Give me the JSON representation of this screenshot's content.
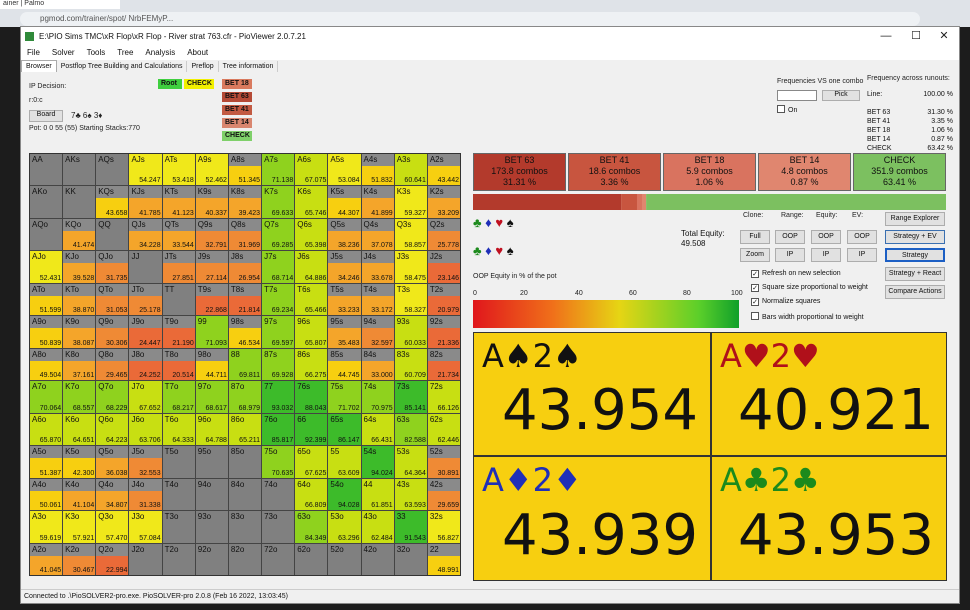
{
  "browser": {
    "tab": "ainer | Palmo",
    "url": "pgmod.com/trainer/spot/ NrbFEMyP..."
  },
  "window": {
    "title": "E:\\PIO Sims TMC\\xR Flop\\xR Flop - River strat 763.cfr - PioViewer 2.0.7.21",
    "minimize": "—",
    "maximize": "☐",
    "close": "✕"
  },
  "menu": [
    "File",
    "Solver",
    "Tools",
    "Tree",
    "Analysis",
    "About"
  ],
  "tabs": [
    "Browser",
    "Postflop Tree Building and Calculations",
    "Preflop",
    "Tree information"
  ],
  "decision": {
    "label": "IP Decision:",
    "hand": "r:0:c",
    "board_btn": "Board",
    "board_cards": "7♣ 6♠ 3♦",
    "pot": "Pot: 0 0 55 (55) Starting Stacks:770"
  },
  "tree": {
    "root": "Root",
    "check": "CHECK",
    "actions": [
      "BET 18",
      "BET 63",
      "BET 41",
      "BET 14",
      "CHECK"
    ]
  },
  "freq_vs": {
    "label": "Frequencies VS one combo",
    "pick": "Pick",
    "on": "On"
  },
  "freq_runouts": {
    "label": "Frequency across runouts:",
    "rows": [
      [
        "Line:",
        "100.00 %"
      ],
      [
        "BET 63",
        "31.30 %"
      ],
      [
        "BET 41",
        "3.35 %"
      ],
      [
        "BET 18",
        "1.06 %"
      ],
      [
        "BET 14",
        "0.87 %"
      ],
      [
        "CHECK",
        "63.42 %"
      ]
    ]
  },
  "strategy": [
    {
      "name": "BET 63",
      "combos": "173.8 combos",
      "pct": "31.31 %",
      "color": "#b33a2c"
    },
    {
      "name": "BET 41",
      "combos": "18.6 combos",
      "pct": "3.36 %",
      "color": "#c8553f"
    },
    {
      "name": "BET 18",
      "combos": "5.9 combos",
      "pct": "1.06 %",
      "color": "#d9735f"
    },
    {
      "name": "BET 14",
      "combos": "4.8 combos",
      "pct": "0.87 %",
      "color": "#e0866f"
    },
    {
      "name": "CHECK",
      "combos": "351.9 combos",
      "pct": "63.41 %",
      "color": "#7cc060"
    }
  ],
  "suits_row1": [
    "♣",
    "♦",
    "♥",
    "♠"
  ],
  "suits_row2": [
    "♣",
    "♦",
    "♥",
    "♠"
  ],
  "oop_equity_label": "OOP Equity in % of the pot",
  "scale": [
    "0",
    "20",
    "40",
    "60",
    "80",
    "100"
  ],
  "equity": {
    "label": "Total Equity:",
    "value": "49.508"
  },
  "controls": {
    "clone": "Clone:",
    "range": "Range:",
    "equity": "Equity:",
    "ev": "EV:",
    "full": "Full",
    "zoom": "Zoom",
    "oop": "OOP",
    "ip": "IP",
    "range_explorer": "Range Explorer",
    "strategy_ev": "Strategy + EV",
    "strategy": "Strategy",
    "strategy_react": "Strategy + React",
    "compare": "Compare Actions"
  },
  "checkboxes": [
    {
      "label": "Refresh on new selection",
      "checked": "✓"
    },
    {
      "label": "Square size proportional to weight",
      "checked": "✓"
    },
    {
      "label": "Normalize squares",
      "checked": "✓"
    },
    {
      "label": "Bars width proportional to weight",
      "checked": ""
    }
  ],
  "cards": [
    {
      "r1": "A",
      "s1": "♠",
      "r2": "2",
      "s2": "♠",
      "color": "#111",
      "value": "43.954"
    },
    {
      "r1": "A",
      "s1": "♥",
      "r2": "2",
      "s2": "♥",
      "color": "#b0101a",
      "value": "40.921"
    },
    {
      "r1": "A",
      "s1": "♦",
      "r2": "2",
      "s2": "♦",
      "color": "#1f2fb8",
      "value": "43.939"
    },
    {
      "r1": "A",
      "s1": "♣",
      "r2": "2",
      "s2": "♣",
      "color": "#1c8a1c",
      "value": "43.953"
    }
  ],
  "status": "Connected to .\\PioSOLVER2-pro.exe. PioSOLVER-pro 2.0.8 (Feb 16 2022, 13:03:45)",
  "grid": [
    [
      [
        "AA",
        ""
      ],
      [
        "AKs",
        ""
      ],
      [
        "AQs",
        ""
      ],
      [
        "AJs",
        "54.247"
      ],
      [
        "ATs",
        "53.418"
      ],
      [
        "A9s",
        "52.462"
      ],
      [
        "A8s",
        "51.345"
      ],
      [
        "A7s",
        "71.138"
      ],
      [
        "A6s",
        "67.075"
      ],
      [
        "A5s",
        "53.084"
      ],
      [
        "A4s",
        "51.832"
      ],
      [
        "A3s",
        "60.641"
      ],
      [
        "A2s",
        "43.442"
      ]
    ],
    [
      [
        "AKo",
        ""
      ],
      [
        "KK",
        ""
      ],
      [
        "KQs",
        "43.658"
      ],
      [
        "KJs",
        "41.785"
      ],
      [
        "KTs",
        "41.123"
      ],
      [
        "K9s",
        "40.337"
      ],
      [
        "K8s",
        "39.423"
      ],
      [
        "K7s",
        "69.633"
      ],
      [
        "K6s",
        "65.746"
      ],
      [
        "K5s",
        "44.307"
      ],
      [
        "K4s",
        "41.899"
      ],
      [
        "K3s",
        "59.327"
      ],
      [
        "K2s",
        "33.209"
      ]
    ],
    [
      [
        "AQo",
        ""
      ],
      [
        "KQo",
        "41.474"
      ],
      [
        "QQ",
        ""
      ],
      [
        "QJs",
        "34.228"
      ],
      [
        "QTs",
        "33.544"
      ],
      [
        "Q9s",
        "32.791"
      ],
      [
        "Q8s",
        "31.969"
      ],
      [
        "Q7s",
        "69.285"
      ],
      [
        "Q6s",
        "65.398"
      ],
      [
        "Q5s",
        "38.236"
      ],
      [
        "Q4s",
        "37.078"
      ],
      [
        "Q3s",
        "58.857"
      ],
      [
        "Q2s",
        "25.778"
      ]
    ],
    [
      [
        "AJo",
        "52.431"
      ],
      [
        "KJo",
        "39.528"
      ],
      [
        "QJo",
        "31.735"
      ],
      [
        "JJ",
        ""
      ],
      [
        "JTs",
        "27.851"
      ],
      [
        "J9s",
        "27.114"
      ],
      [
        "J8s",
        "26.954"
      ],
      [
        "J7s",
        "68.714"
      ],
      [
        "J6s",
        "64.886"
      ],
      [
        "J5s",
        "34.246"
      ],
      [
        "J4s",
        "33.678"
      ],
      [
        "J3s",
        "58.475"
      ],
      [
        "J2s",
        "23.146"
      ]
    ],
    [
      [
        "ATo",
        "51.599"
      ],
      [
        "KTo",
        "38.870"
      ],
      [
        "QTo",
        "31.053"
      ],
      [
        "JTo",
        "25.178"
      ],
      [
        "TT",
        ""
      ],
      [
        "T9s",
        "22.868"
      ],
      [
        "T8s",
        "21.814"
      ],
      [
        "T7s",
        "69.234"
      ],
      [
        "T6s",
        "65.466"
      ],
      [
        "T5s",
        "33.233"
      ],
      [
        "T4s",
        "33.172"
      ],
      [
        "T3s",
        "58.327"
      ],
      [
        "T2s",
        "20.979"
      ]
    ],
    [
      [
        "A9o",
        "50.839"
      ],
      [
        "K9o",
        "38.087"
      ],
      [
        "Q9o",
        "30.306"
      ],
      [
        "J9o",
        "24.447"
      ],
      [
        "T9o",
        "21.190"
      ],
      [
        "99",
        "71.093"
      ],
      [
        "98s",
        "46.534"
      ],
      [
        "97s",
        "69.597"
      ],
      [
        "96s",
        "65.807"
      ],
      [
        "95s",
        "35.483"
      ],
      [
        "94s",
        "32.597"
      ],
      [
        "93s",
        "60.033"
      ],
      [
        "92s",
        "21.336"
      ]
    ],
    [
      [
        "A8o",
        "49.504"
      ],
      [
        "K8o",
        "37.161"
      ],
      [
        "Q8o",
        "29.465"
      ],
      [
        "J8o",
        "24.252"
      ],
      [
        "T8o",
        "20.514"
      ],
      [
        "98o",
        "44.711"
      ],
      [
        "88",
        "69.811"
      ],
      [
        "87s",
        "69.928"
      ],
      [
        "86s",
        "66.275"
      ],
      [
        "85s",
        "44.745"
      ],
      [
        "84s",
        "33.000"
      ],
      [
        "83s",
        "60.709"
      ],
      [
        "82s",
        "21.734"
      ]
    ],
    [
      [
        "A7o",
        "70.064"
      ],
      [
        "K7o",
        "68.557"
      ],
      [
        "Q7o",
        "68.229"
      ],
      [
        "J7o",
        "67.652"
      ],
      [
        "T7o",
        "68.217"
      ],
      [
        "97o",
        "68.617"
      ],
      [
        "87o",
        "68.979"
      ],
      [
        "77",
        "93.032"
      ],
      [
        "76s",
        "88.043"
      ],
      [
        "75s",
        "71.702"
      ],
      [
        "74s",
        "70.975"
      ],
      [
        "73s",
        "85.141"
      ],
      [
        "72s",
        "66.126"
      ]
    ],
    [
      [
        "A6o",
        "65.870"
      ],
      [
        "K6o",
        "64.651"
      ],
      [
        "Q6o",
        "64.223"
      ],
      [
        "J6o",
        "63.706"
      ],
      [
        "T6o",
        "64.333"
      ],
      [
        "96o",
        "64.788"
      ],
      [
        "86o",
        "65.211"
      ],
      [
        "76o",
        "85.817"
      ],
      [
        "66",
        "92.399"
      ],
      [
        "65s",
        "86.147"
      ],
      [
        "64s",
        "66.431"
      ],
      [
        "63s",
        "82.588"
      ],
      [
        "62s",
        "62.446"
      ]
    ],
    [
      [
        "A5o",
        "51.387"
      ],
      [
        "K5o",
        "42.300"
      ],
      [
        "Q5o",
        "36.038"
      ],
      [
        "J5o",
        "32.553"
      ],
      [
        "T5o",
        ""
      ],
      [
        "95o",
        ""
      ],
      [
        "85o",
        ""
      ],
      [
        "75o",
        "70.635"
      ],
      [
        "65o",
        "67.625"
      ],
      [
        "55",
        "63.609"
      ],
      [
        "54s",
        "94.024"
      ],
      [
        "53s",
        "64.364"
      ],
      [
        "52s",
        "30.891"
      ]
    ],
    [
      [
        "A4o",
        "50.061"
      ],
      [
        "K4o",
        "41.104"
      ],
      [
        "Q4o",
        "34.807"
      ],
      [
        "J4o",
        "31.338"
      ],
      [
        "T4o",
        ""
      ],
      [
        "94o",
        ""
      ],
      [
        "84o",
        ""
      ],
      [
        "74o",
        ""
      ],
      [
        "64o",
        "66.809"
      ],
      [
        "54o",
        "94.028"
      ],
      [
        "44",
        "61.851"
      ],
      [
        "43s",
        "63.593"
      ],
      [
        "42s",
        "29.659"
      ]
    ],
    [
      [
        "A3o",
        "59.619"
      ],
      [
        "K3o",
        "57.921"
      ],
      [
        "Q3o",
        "57.470"
      ],
      [
        "J3o",
        "57.084"
      ],
      [
        "T3o",
        ""
      ],
      [
        "93o",
        ""
      ],
      [
        "83o",
        ""
      ],
      [
        "73o",
        ""
      ],
      [
        "63o",
        "84.349"
      ],
      [
        "53o",
        "63.296"
      ],
      [
        "43o",
        "62.484"
      ],
      [
        "33",
        "91.543"
      ],
      [
        "32s",
        "56.827"
      ]
    ],
    [
      [
        "A2o",
        "41.045"
      ],
      [
        "K2o",
        "30.467"
      ],
      [
        "Q2o",
        "22.994"
      ],
      [
        "J2o",
        ""
      ],
      [
        "T2o",
        ""
      ],
      [
        "92o",
        ""
      ],
      [
        "82o",
        ""
      ],
      [
        "72o",
        ""
      ],
      [
        "62o",
        ""
      ],
      [
        "52o",
        ""
      ],
      [
        "42o",
        ""
      ],
      [
        "32o",
        ""
      ],
      [
        "22",
        "48.991"
      ]
    ]
  ]
}
